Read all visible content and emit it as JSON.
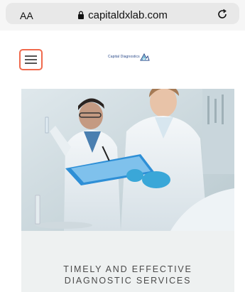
{
  "browser": {
    "text_size_label": "AA",
    "url": "capitaldxlab.com",
    "icons": {
      "lock": "lock-icon",
      "reload": "reload-icon"
    }
  },
  "header": {
    "logo_text": "Capital Diagnostics",
    "menu_icon": "hamburger-menu-icon",
    "accent_color": "#f06a4d"
  },
  "hero": {
    "image": "lab-scientists-photo"
  },
  "tagline": {
    "line1": "TIMELY AND EFFECTIVE",
    "line2": "DIAGNOSTIC SERVICES"
  }
}
